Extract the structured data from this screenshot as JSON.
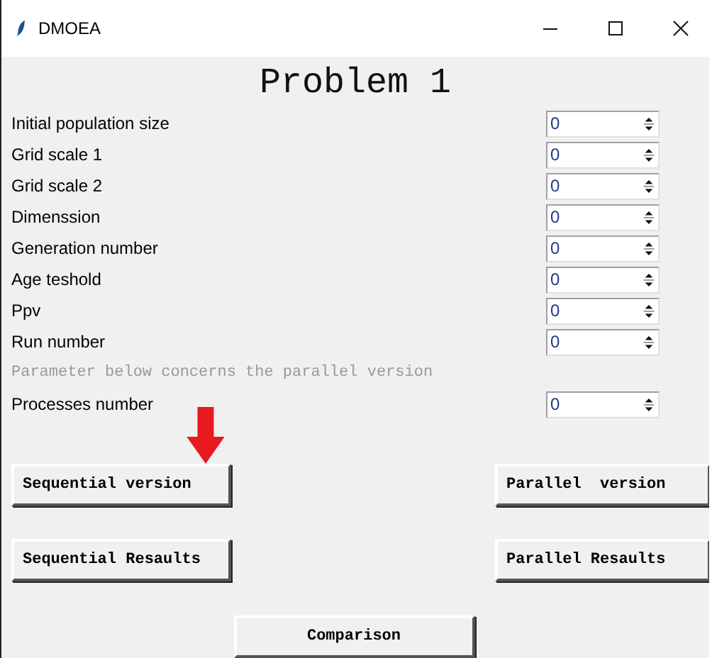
{
  "window": {
    "title": "DMOEA"
  },
  "heading": "Problem 1",
  "parameters": [
    {
      "label": "Initial population size",
      "value": "0"
    },
    {
      "label": "Grid scale 1",
      "value": "0"
    },
    {
      "label": "Grid scale 2",
      "value": "0"
    },
    {
      "label": "Dimenssion",
      "value": "0"
    },
    {
      "label": "Generation number",
      "value": "0"
    },
    {
      "label": "Age teshold",
      "value": "0"
    },
    {
      "label": "Ppv",
      "value": "0"
    },
    {
      "label": "Run number",
      "value": "0"
    }
  ],
  "note": "Parameter below concerns the parallel version",
  "parallel_parameters": [
    {
      "label": "Processes number",
      "value": "0"
    }
  ],
  "buttons": {
    "sequential_version": "Sequential version",
    "parallel_version": "Parallel  version",
    "sequential_results": "Sequential Resaults",
    "parallel_results": "Parallel Resaults",
    "comparison": "Comparison"
  }
}
